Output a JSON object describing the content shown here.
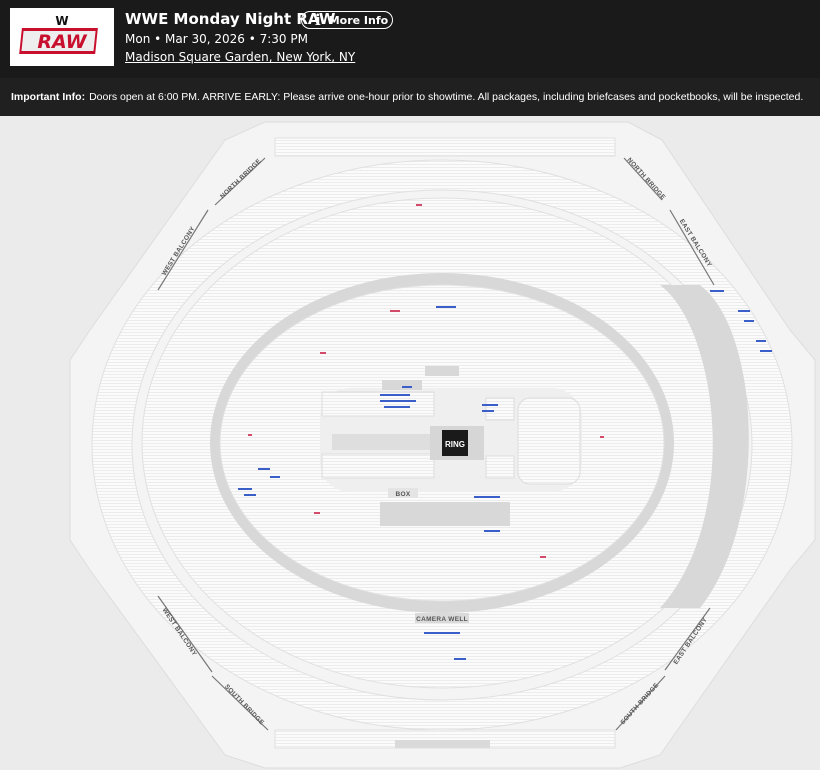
{
  "header": {
    "logo": {
      "icon": "wwe-raw-logo",
      "brand_text": "RAW",
      "mark_text": "W"
    },
    "title": "WWE Monday Night RAW",
    "more_info_label": "More Info",
    "more_info_icon": "info-icon",
    "date": "Mon • Mar 30, 2026 • 7:30 PM",
    "venue": "Madison Square Garden, New York, NY"
  },
  "info_bar": {
    "label": "Important Info:",
    "text": "Doors open at 6:00 PM. ARRIVE EARLY: Please arrive one-hour prior to showtime. All packages, including briefcases and pocketbooks, will be inspected."
  },
  "seat_map": {
    "ring_label": "RING",
    "box_label": "BOX",
    "camera_well_label": "CAMERA WELL",
    "balcony_labels": {
      "north_bridge_left": "NORTH BRIDGE",
      "north_bridge_right": "NORTH BRIDGE",
      "west_balcony_top": "WEST BALCONY",
      "east_balcony_top": "EAST BALCONY",
      "west_balcony_bottom": "WEST BALCONY",
      "east_balcony_bottom": "EAST BALCONY",
      "south_bridge_left": "SOUTH BRIDGE",
      "south_bridge_right": "SOUTH BRIDGE"
    },
    "colors": {
      "available_seat": "#3a5fc9",
      "highlight_seat": "#d44a6a",
      "section": "#fbfbfb",
      "walkway": "#d8d8d8"
    }
  }
}
